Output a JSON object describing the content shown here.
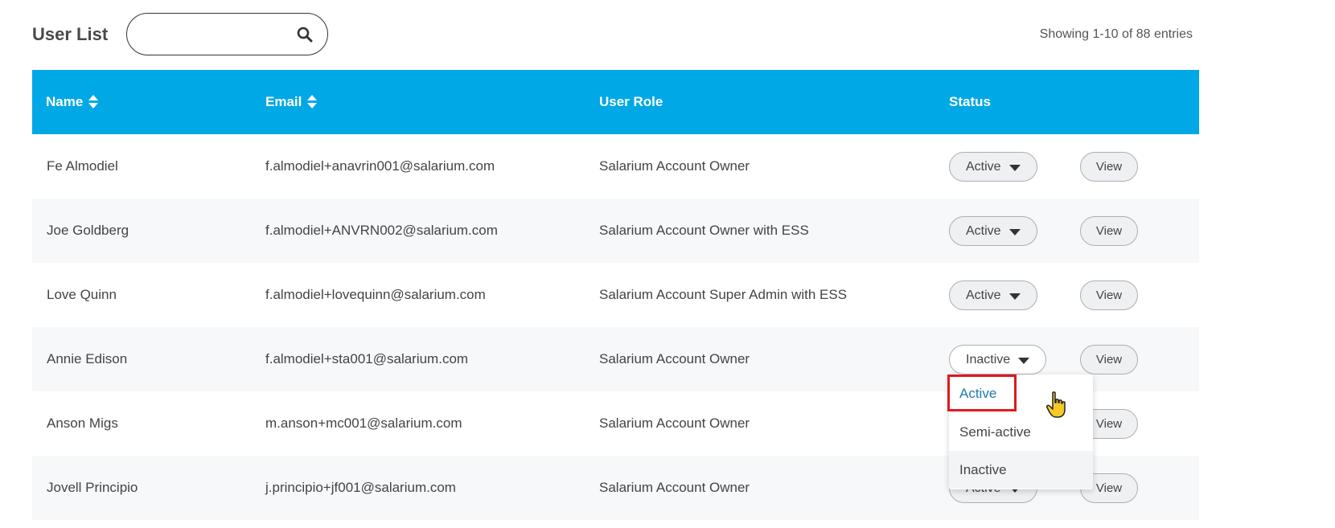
{
  "header": {
    "title": "User List",
    "search_value": "",
    "entries_text": "Showing 1-10 of 88 entries"
  },
  "table": {
    "columns": {
      "name": "Name",
      "email": "Email",
      "role": "User Role",
      "status": "Status"
    },
    "rows": [
      {
        "name": "Fe Almodiel",
        "email": "f.almodiel+anavrin001@salarium.com",
        "role": "Salarium Account Owner",
        "status": "Active",
        "view": "View"
      },
      {
        "name": "Joe Goldberg",
        "email": "f.almodiel+ANVRN002@salarium.com",
        "role": "Salarium Account Owner with ESS",
        "status": "Active",
        "view": "View"
      },
      {
        "name": "Love Quinn",
        "email": "f.almodiel+lovequinn@salarium.com",
        "role": "Salarium Account Super Admin with ESS",
        "status": "Active",
        "view": "View"
      },
      {
        "name": "Annie Edison",
        "email": "f.almodiel+sta001@salarium.com",
        "role": "Salarium Account Owner",
        "status": "Inactive",
        "view": "View"
      },
      {
        "name": "Anson Migs",
        "email": "m.anson+mc001@salarium.com",
        "role": "Salarium Account Owner",
        "status": "",
        "view": "View"
      },
      {
        "name": "Jovell Principio",
        "email": "j.principio+jf001@salarium.com",
        "role": "Salarium Account Owner",
        "status": "Active",
        "view": "View"
      }
    ]
  },
  "dropdown": {
    "options": [
      "Active",
      "Semi-active",
      "Inactive"
    ],
    "highlighted": "Active"
  },
  "colors": {
    "header_bg": "#00a8e6",
    "highlight_border": "#e0191e",
    "link_blue": "#1f7aa8"
  }
}
